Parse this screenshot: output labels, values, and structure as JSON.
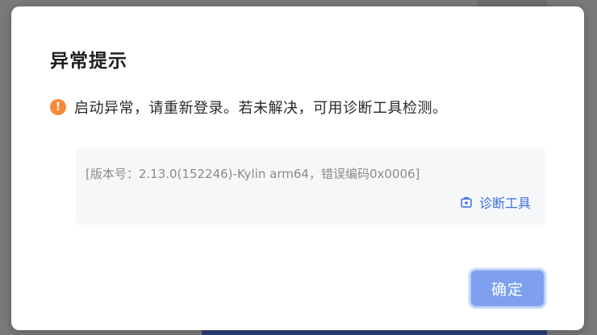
{
  "dialog": {
    "title": "异常提示",
    "message": "启动异常，请重新登录。若未解决，可用诊断工具检测。",
    "version_info": "[版本号：2.13.0(152246)-Kylin arm64，错误编码0x0006]",
    "diagnostic_link_label": "诊断工具",
    "confirm_label": "确定",
    "warn_icon_glyph": "!"
  },
  "colors": {
    "warning": "#f5893a",
    "link": "#3b6fe0",
    "primary_button": "#7ea0ef"
  },
  "icons": {
    "warning": "exclamation-circle-icon",
    "diagnostic": "toolbox-icon"
  }
}
